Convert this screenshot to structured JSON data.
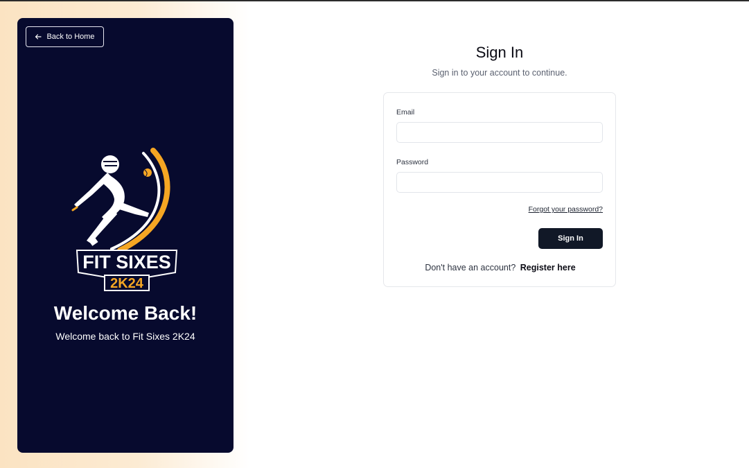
{
  "left_panel": {
    "back_label": "Back to Home",
    "logo": {
      "line1": "FIT SIXES",
      "line2": "2K24",
      "icon": "cricket-batsman-logo"
    },
    "welcome_title": "Welcome Back!",
    "welcome_subtitle": "Welcome back to Fit Sixes 2K24"
  },
  "signin": {
    "title": "Sign In",
    "subtitle": "Sign in to your account to continue.",
    "email_label": "Email",
    "email_value": "",
    "password_label": "Password",
    "password_value": "",
    "forgot_label": "Forgot your password?",
    "submit_label": "Sign In",
    "register_prompt": "Don't have an account?",
    "register_link": "Register here"
  },
  "colors": {
    "panel_bg": "#070a2e",
    "accent_orange": "#f5a623",
    "button_bg": "#111827",
    "page_glow": "#fbe3c2"
  }
}
